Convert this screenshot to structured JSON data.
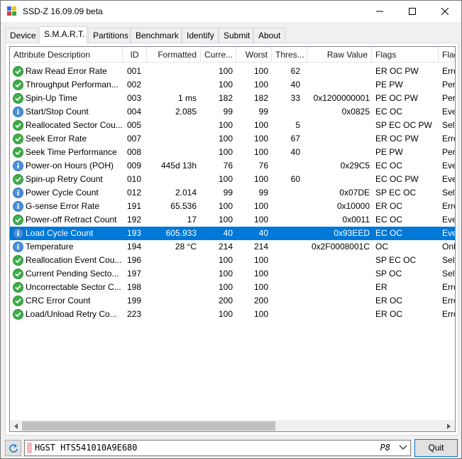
{
  "window": {
    "title": "SSD-Z 16.09.09 beta",
    "icon": "ssdz-app-icon",
    "controls": [
      "minimize-icon",
      "maximize-icon",
      "close-icon"
    ]
  },
  "tabs": [
    {
      "label": "Device",
      "active": false
    },
    {
      "label": "S.M.A.R.T.",
      "active": true
    },
    {
      "label": "Partitions",
      "active": false
    },
    {
      "label": "Benchmark",
      "active": false
    },
    {
      "label": "Identify",
      "active": false
    },
    {
      "label": "Submit",
      "active": false
    },
    {
      "label": "About",
      "active": false
    }
  ],
  "smart": {
    "columns": [
      "Attribute Description",
      "ID",
      "Formatted",
      "Curre...",
      "Worst",
      "Thres...",
      "Raw Value",
      "Flags",
      "Flag"
    ],
    "rows": [
      {
        "status": "ok",
        "desc": "Raw Read Error Rate",
        "id": "001",
        "formatted": "",
        "current": "100",
        "worst": "100",
        "threshold": "62",
        "raw": "",
        "flags": "ER OC PW",
        "flag": "Erro"
      },
      {
        "status": "ok",
        "desc": "Throughput Performan...",
        "id": "002",
        "formatted": "",
        "current": "100",
        "worst": "100",
        "threshold": "40",
        "raw": "",
        "flags": "PE PW",
        "flag": "Perfo"
      },
      {
        "status": "ok",
        "desc": "Spin-Up Time",
        "id": "003",
        "formatted": "1 ms",
        "current": "182",
        "worst": "182",
        "threshold": "33",
        "raw": "0x1200000001",
        "flags": "PE OC PW",
        "flag": "Perfo"
      },
      {
        "status": "info",
        "desc": "Start/Stop Count",
        "id": "004",
        "formatted": "2.085",
        "current": "99",
        "worst": "99",
        "threshold": "",
        "raw": "0x0825",
        "flags": "EC OC",
        "flag": "Ever"
      },
      {
        "status": "ok",
        "desc": "Reallocated Sector Cou...",
        "id": "005",
        "formatted": "",
        "current": "100",
        "worst": "100",
        "threshold": "5",
        "raw": "",
        "flags": "SP EC OC PW",
        "flag": "SelfP"
      },
      {
        "status": "ok",
        "desc": "Seek Error Rate",
        "id": "007",
        "formatted": "",
        "current": "100",
        "worst": "100",
        "threshold": "67",
        "raw": "",
        "flags": "ER OC PW",
        "flag": "Erro"
      },
      {
        "status": "ok",
        "desc": "Seek Time Performance",
        "id": "008",
        "formatted": "",
        "current": "100",
        "worst": "100",
        "threshold": "40",
        "raw": "",
        "flags": "PE PW",
        "flag": "Perfo"
      },
      {
        "status": "info",
        "desc": "Power-on Hours (POH)",
        "id": "009",
        "formatted": "445d 13h",
        "current": "76",
        "worst": "76",
        "threshold": "",
        "raw": "0x29C5",
        "flags": "EC OC",
        "flag": "Ever"
      },
      {
        "status": "ok",
        "desc": "Spin-up Retry Count",
        "id": "010",
        "formatted": "",
        "current": "100",
        "worst": "100",
        "threshold": "60",
        "raw": "",
        "flags": "EC OC PW",
        "flag": "Ever"
      },
      {
        "status": "info",
        "desc": "Power Cycle Count",
        "id": "012",
        "formatted": "2.014",
        "current": "99",
        "worst": "99",
        "threshold": "",
        "raw": "0x07DE",
        "flags": "SP EC OC",
        "flag": "SelfP"
      },
      {
        "status": "info",
        "desc": "G-sense Error Rate",
        "id": "191",
        "formatted": "65.536",
        "current": "100",
        "worst": "100",
        "threshold": "",
        "raw": "0x10000",
        "flags": "ER OC",
        "flag": "Erro"
      },
      {
        "status": "ok",
        "desc": "Power-off Retract Count",
        "id": "192",
        "formatted": "17",
        "current": "100",
        "worst": "100",
        "threshold": "",
        "raw": "0x0011",
        "flags": "EC OC",
        "flag": "Ever"
      },
      {
        "status": "info",
        "desc": "Load Cycle Count",
        "id": "193",
        "formatted": "605.933",
        "current": "40",
        "worst": "40",
        "threshold": "",
        "raw": "0x93EED",
        "flags": "EC OC",
        "flag": "Ever",
        "selected": true
      },
      {
        "status": "info",
        "desc": "Temperature",
        "id": "194",
        "formatted": "28 °C",
        "current": "214",
        "worst": "214",
        "threshold": "",
        "raw": "0x2F0008001C",
        "flags": "OC",
        "flag": "Onli"
      },
      {
        "status": "ok",
        "desc": "Reallocation Event Cou...",
        "id": "196",
        "formatted": "",
        "current": "100",
        "worst": "100",
        "threshold": "",
        "raw": "",
        "flags": "SP EC OC",
        "flag": "SelfP"
      },
      {
        "status": "ok",
        "desc": "Current Pending Secto...",
        "id": "197",
        "formatted": "",
        "current": "100",
        "worst": "100",
        "threshold": "",
        "raw": "",
        "flags": "SP OC",
        "flag": "SelfP"
      },
      {
        "status": "ok",
        "desc": "Uncorrectable Sector C...",
        "id": "198",
        "formatted": "",
        "current": "100",
        "worst": "100",
        "threshold": "",
        "raw": "",
        "flags": "ER",
        "flag": "Erro"
      },
      {
        "status": "ok",
        "desc": "CRC Error Count",
        "id": "199",
        "formatted": "",
        "current": "200",
        "worst": "200",
        "threshold": "",
        "raw": "",
        "flags": "ER OC",
        "flag": "Erro"
      },
      {
        "status": "ok",
        "desc": "Load/Unload Retry Co...",
        "id": "223",
        "formatted": "",
        "current": "100",
        "worst": "100",
        "threshold": "",
        "raw": "",
        "flags": "ER OC",
        "flag": "Erro"
      }
    ]
  },
  "footer": {
    "drive_name": "HGST HTS541010A9E680",
    "drive_letter": "P8",
    "quit_label": "Quit",
    "refresh_icon": "refresh-icon"
  },
  "colors": {
    "selection": "#0078d7",
    "ok_status": "#3fae49",
    "info_status": "#4a90d9",
    "drive_swatch": "#f7b6c4"
  }
}
